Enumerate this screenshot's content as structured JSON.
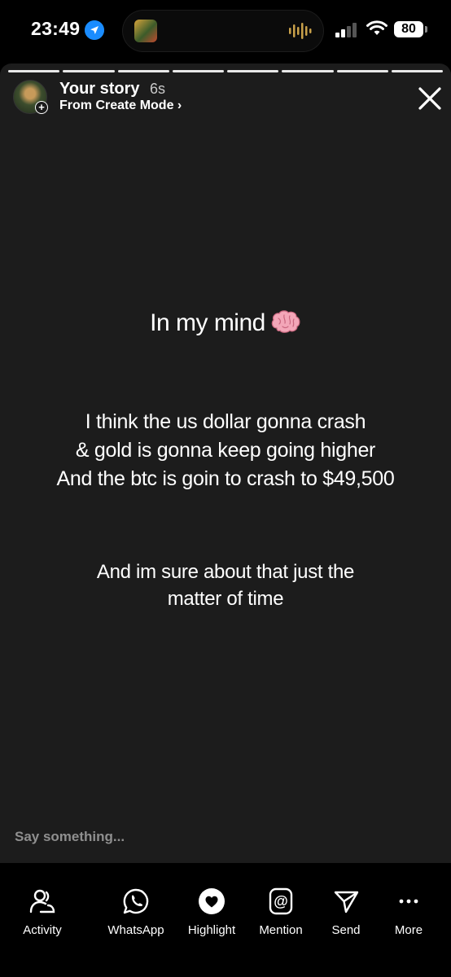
{
  "status_bar": {
    "time": "23:49",
    "battery": "80"
  },
  "story": {
    "owner": "Your story",
    "age": "6s",
    "source": "From Create Mode ›",
    "heading": "In my mind",
    "lines1": [
      "I think the us dollar gonna crash",
      "& gold is gonna keep going higher",
      "And the btc is goin to crash to $49,500"
    ],
    "lines2": [
      "And im sure about that just the",
      "matter of time"
    ],
    "progress_segments_total": 8,
    "progress_segments_done": 8
  },
  "reply": {
    "placeholder": "Say something..."
  },
  "actions": [
    {
      "label": "Activity",
      "icon": "activity-icon"
    },
    {
      "label": "WhatsApp",
      "icon": "whatsapp-icon"
    },
    {
      "label": "Highlight",
      "icon": "highlight-heart-icon"
    },
    {
      "label": "Mention",
      "icon": "mention-at-icon"
    },
    {
      "label": "Send",
      "icon": "send-icon"
    },
    {
      "label": "More",
      "icon": "more-dots-icon"
    }
  ],
  "colors": {
    "background": "#000000",
    "story_card": "#1c1c1c",
    "location_blue": "#1a8cff",
    "brain_pink": "#f3a6b8",
    "text": "#ffffff"
  }
}
